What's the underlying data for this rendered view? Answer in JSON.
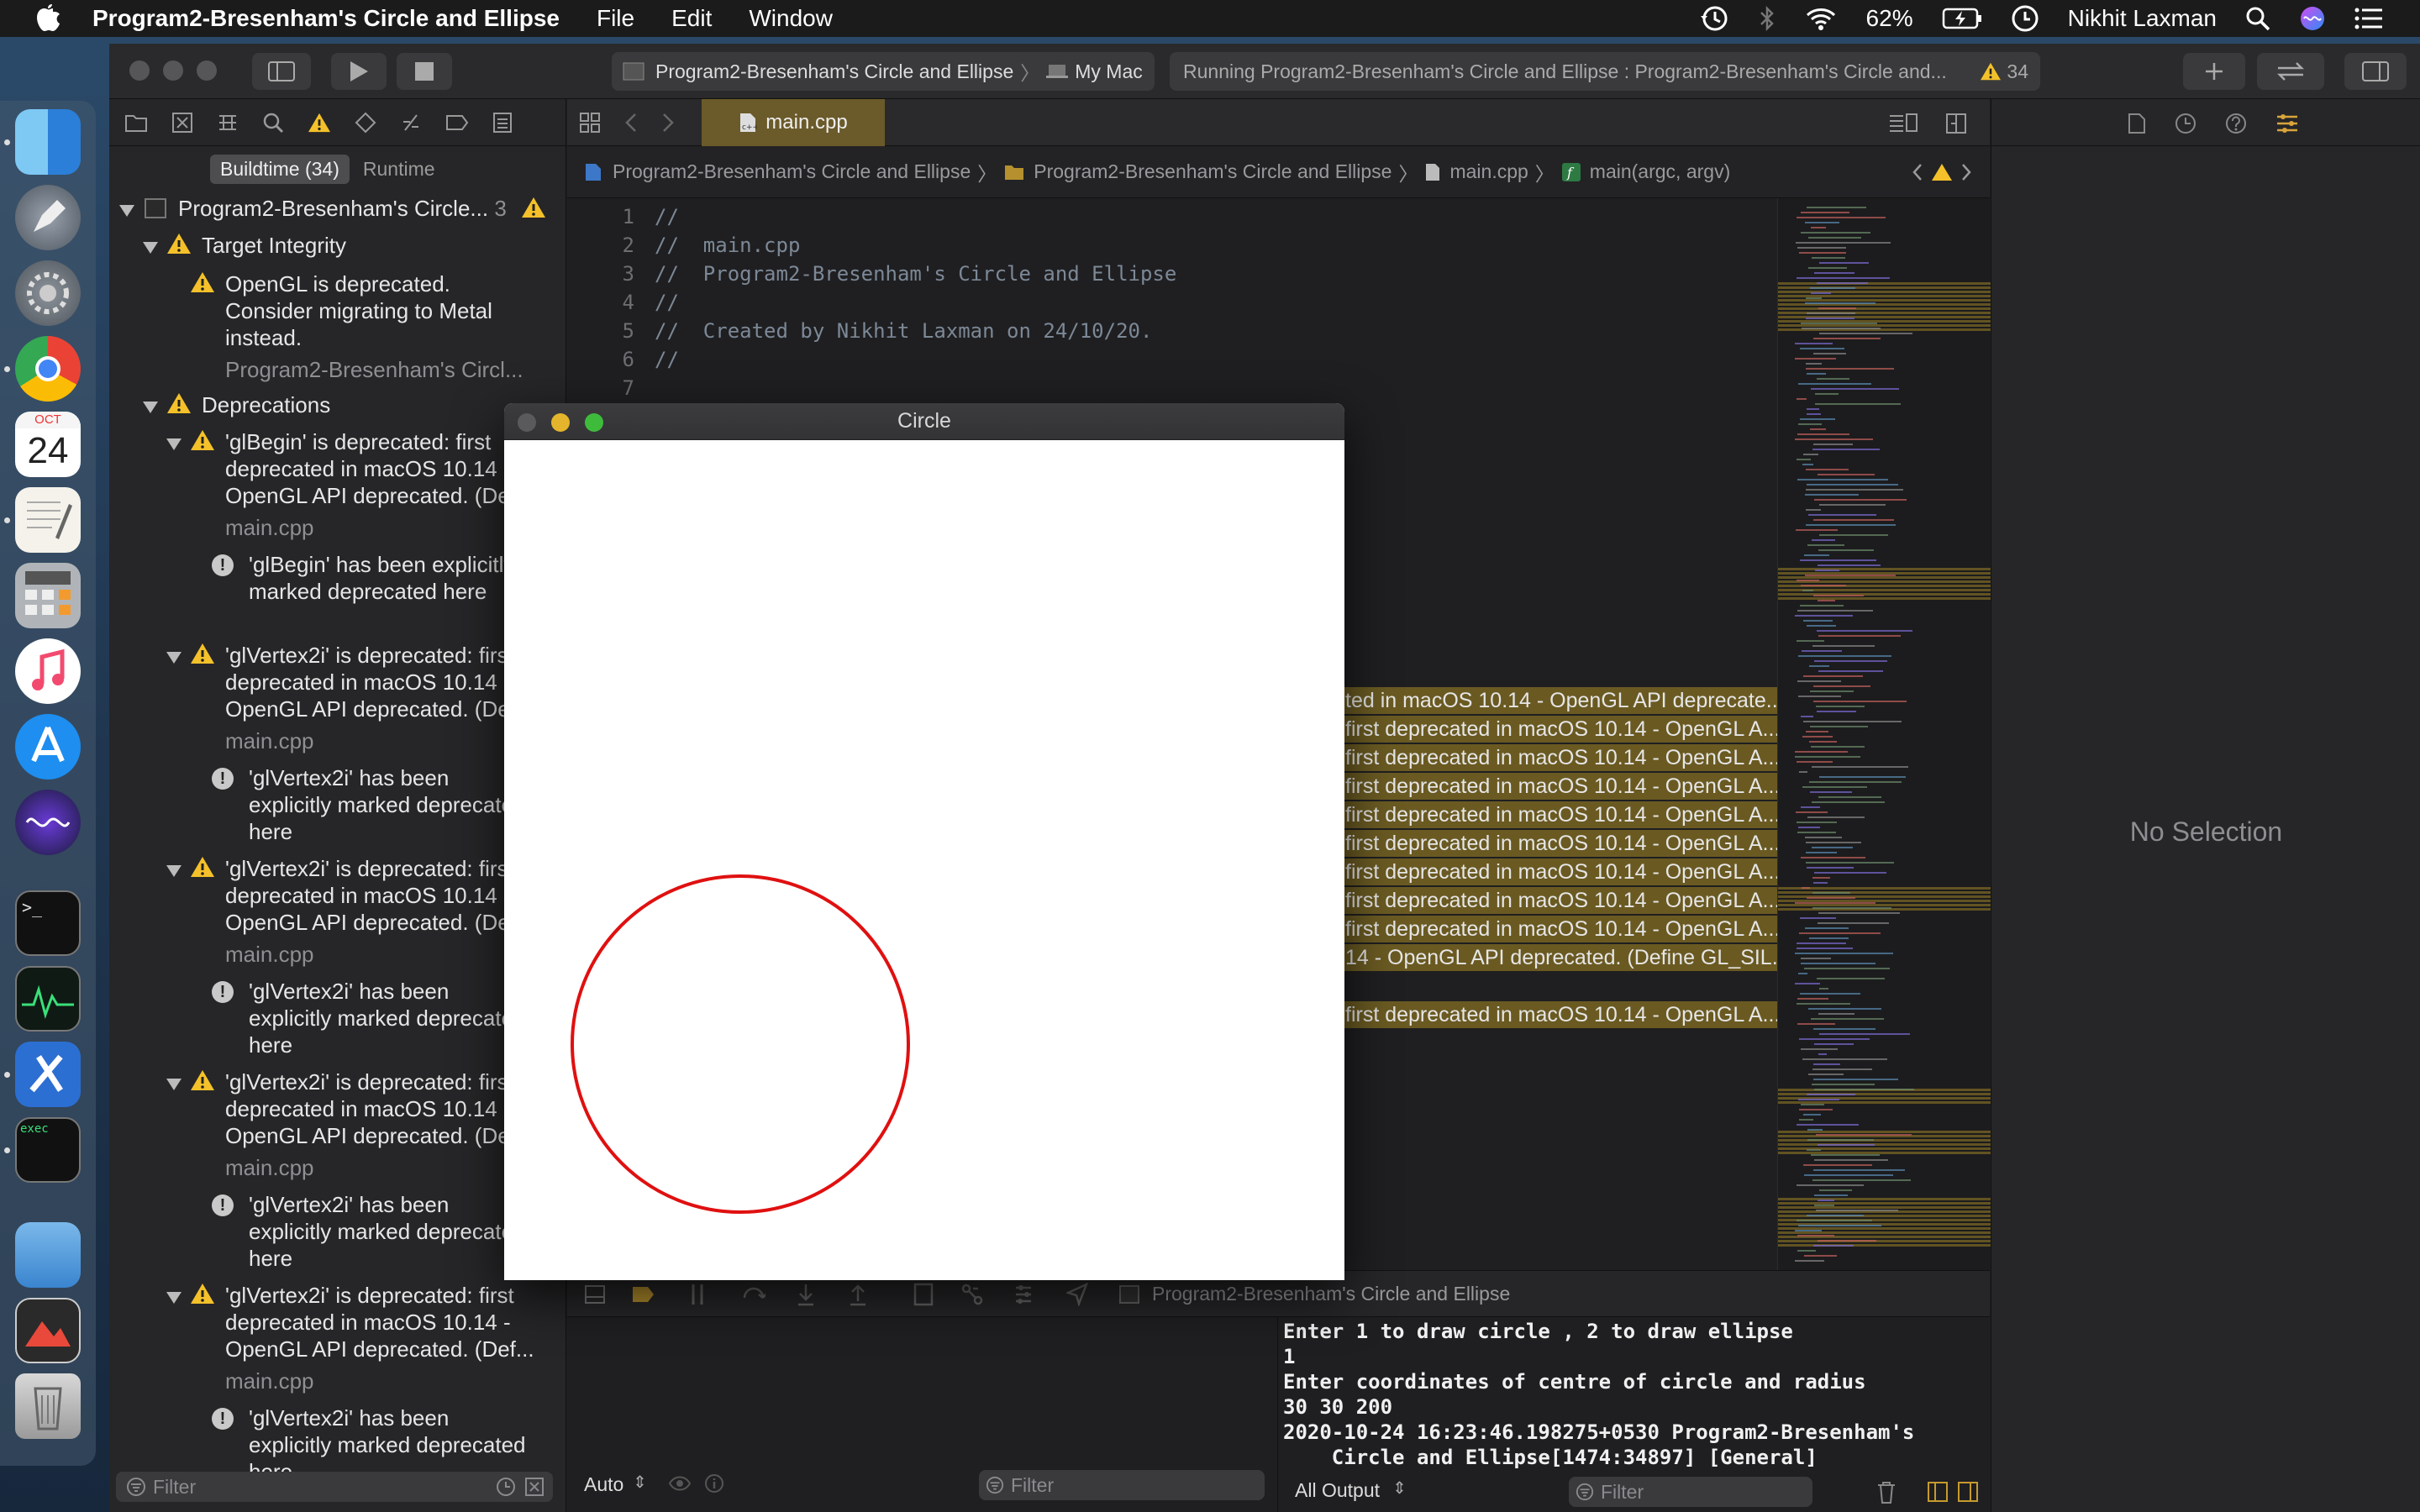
{
  "menubar": {
    "app_name": "Program2-Bresenham's Circle and Ellipse",
    "menus": [
      "File",
      "Edit",
      "Window"
    ],
    "battery": "62%",
    "user": "Nikhit Laxman"
  },
  "dock": {
    "calendar_month": "OCT",
    "calendar_day": "24",
    "terminal_prompt": ">_",
    "exec_label": "exec"
  },
  "toolbar": {
    "scheme": "Program2-Bresenham's Circle and Ellipse",
    "destination": "My Mac",
    "activity": "Running Program2-Bresenham's Circle and Ellipse : Program2-Bresenham's Circle and...",
    "warning_count": "34"
  },
  "navigator": {
    "tab_buildtime": "Buildtime (34)",
    "tab_runtime": "Runtime",
    "filter_placeholder": "Filter",
    "root": "Program2-Bresenham's Circle...",
    "root_count": "3",
    "groups": {
      "target_integrity": "Target Integrity",
      "deprecations": "Deprecations"
    },
    "target_issue": {
      "line1": "OpenGL is deprecated.",
      "line2": "Consider migrating to Metal",
      "line3": "instead.",
      "file": "Program2-Bresenham's Circl..."
    },
    "issues": [
      {
        "l1": "'glBegin' is deprecated: first",
        "l2": "deprecated in macOS 10.14 -",
        "l3": "OpenGL API deprecated. (Def...",
        "file": "main.cpp",
        "n1": "'glBegin' has been explicitly",
        "n2": "marked deprecated here",
        "n3": ""
      },
      {
        "l1": "'glVertex2i' is deprecated: first",
        "l2": "deprecated in macOS 10.14 -",
        "l3": "OpenGL API deprecated. (Def...",
        "file": "main.cpp",
        "n1": "'glVertex2i' has been",
        "n2": "explicitly marked deprecated",
        "n3": "here"
      },
      {
        "l1": "'glVertex2i' is deprecated: first",
        "l2": "deprecated in macOS 10.14 -",
        "l3": "OpenGL API deprecated. (Def...",
        "file": "main.cpp",
        "n1": "'glVertex2i' has been",
        "n2": "explicitly marked deprecated",
        "n3": "here"
      },
      {
        "l1": "'glVertex2i' is deprecated: first",
        "l2": "deprecated in macOS 10.14 -",
        "l3": "OpenGL API deprecated. (Def...",
        "file": "main.cpp",
        "n1": "'glVertex2i' has been",
        "n2": "explicitly marked deprecated",
        "n3": "here"
      },
      {
        "l1": "'glVertex2i' is deprecated: first",
        "l2": "deprecated in macOS 10.14 -",
        "l3": "OpenGL API deprecated. (Def...",
        "file": "main.cpp",
        "n1": "'glVertex2i' has been",
        "n2": "explicitly marked deprecated",
        "n3": "here"
      }
    ]
  },
  "editor": {
    "tab": "main.cpp",
    "jump": [
      "Program2-Bresenham's Circle and Ellipse",
      "Program2-Bresenham's Circle and Ellipse",
      "main.cpp",
      "main(argc, argv)"
    ],
    "line_numbers": [
      "1",
      "2",
      "3",
      "4",
      "5",
      "6",
      "7"
    ],
    "lines": [
      "//",
      "//  main.cpp",
      "//  Program2-Bresenham's Circle and Ellipse",
      "//",
      "//  Created by Nikhit Laxman on 24/10/20.",
      "//",
      ""
    ],
    "inline_issues": [
      "ted in macOS 10.14 - OpenGL API deprecate...",
      " first deprecated in macOS 10.14 - OpenGL A...",
      " first deprecated in macOS 10.14 - OpenGL A...",
      " first deprecated in macOS 10.14 - OpenGL A...",
      " first deprecated in macOS 10.14 - OpenGL A...",
      " first deprecated in macOS 10.14 - OpenGL A...",
      " first deprecated in macOS 10.14 - OpenGL A...",
      " first deprecated in macOS 10.14 - OpenGL A...",
      " first deprecated in macOS 10.14 - OpenGL A...",
      "14 - OpenGL API deprecated. (Define GL_SIL...",
      " first deprecated in macOS 10.14 - OpenGL A..."
    ]
  },
  "debug": {
    "process": "Program2-Bresenham's Circle and Ellipse",
    "auto": "Auto",
    "filter_placeholder": "Filter",
    "output": "All Output",
    "console_lines": [
      "Enter 1 to draw circle , 2 to draw ellipse",
      "1",
      "Enter coordinates of centre of circle and radius",
      "30 30 200",
      "2020-10-24 16:23:46.198275+0530 Program2-Bresenham's",
      "    Circle and Ellipse[1474:34897] [General]"
    ]
  },
  "inspector": {
    "no_selection": "No Selection"
  },
  "gl_window": {
    "title": "Circle"
  },
  "colors": {
    "circle": "#e01010",
    "warning": "#f4c12a",
    "issue_highlight": "#6a5a22"
  }
}
